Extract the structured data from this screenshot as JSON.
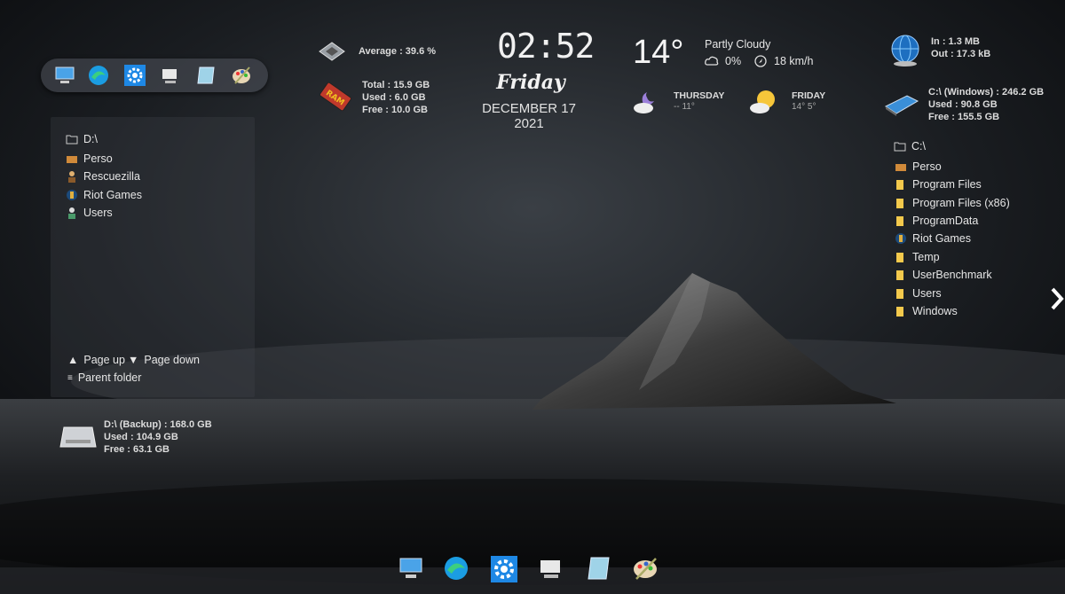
{
  "cpu": {
    "average": "Average : 39.6 %"
  },
  "ram": {
    "total": "Total : 15.9 GB",
    "used": "Used : 6.0 GB",
    "free": "Free : 10.0 GB",
    "icon_text": "RAM"
  },
  "clock": {
    "time": "02:52",
    "day": "Friday",
    "date": "DECEMBER 17 2021"
  },
  "weather": {
    "temp": "14°",
    "condition": "Partly Cloudy",
    "precip": "0%",
    "wind": "18 km/h",
    "forecast": [
      {
        "day": "THURSDAY",
        "temps": "-- 11°",
        "icon": "moon-cloud-icon"
      },
      {
        "day": "FRIDAY",
        "temps": "14° 5°",
        "icon": "sun-cloud-icon"
      }
    ]
  },
  "network": {
    "in": "In : 1.3 MB",
    "out": "Out : 17.3 kB"
  },
  "drive_c": {
    "name": "C:\\ (Windows) : 246.2 GB",
    "used": "Used : 90.8 GB",
    "free": "Free : 155.5 GB"
  },
  "drive_d": {
    "name": "D:\\ (Backup) : 168.0 GB",
    "used": "Used : 104.9 GB",
    "free": "Free : 63.1 GB"
  },
  "left_folder": {
    "path": "D:\\",
    "items": [
      "Perso",
      "Rescuezilla",
      "Riot Games",
      "Users"
    ],
    "page_up": "Page up",
    "page_down": "Page down",
    "parent": "Parent folder"
  },
  "right_folder": {
    "path": "C:\\",
    "items": [
      "Perso",
      "Program Files",
      "Program Files (x86)",
      "ProgramData",
      "Riot Games",
      "Temp",
      "UserBenchmark",
      "Users",
      "Windows"
    ]
  },
  "colors": {
    "accent_blue": "#1e88e5",
    "folder_yellow": "#f3c94c"
  }
}
